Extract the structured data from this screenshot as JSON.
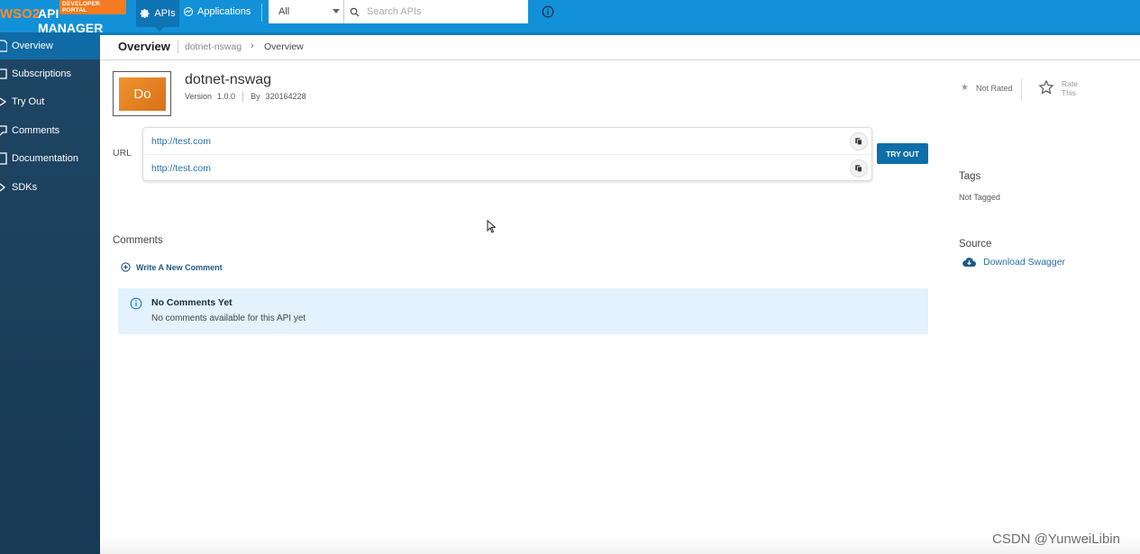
{
  "header": {
    "logo_wso2": "WSO2",
    "logo_title": "API MANAGER",
    "logo_badge": "DEVELOPER PORTAL",
    "nav_apis": "APIs",
    "nav_applications": "Applications",
    "search_filter": "All",
    "search_placeholder": "Search APIs"
  },
  "sidebar": {
    "items": [
      {
        "label": "Overview",
        "active": true
      },
      {
        "label": "Subscriptions"
      },
      {
        "label": "Try Out"
      },
      {
        "label": "Comments"
      },
      {
        "label": "Documentation"
      },
      {
        "label": "SDKs"
      }
    ]
  },
  "breadcrumb": {
    "title": "Overview",
    "api": "dotnet-nswag",
    "current": "Overview"
  },
  "api": {
    "thumb_text": "Do",
    "name": "dotnet-nswag",
    "version_label": "Version",
    "version": "1.0.0",
    "by_label": "By",
    "owner": "320164228",
    "rating_text": "Not Rated",
    "rate_this_line1": "Rate",
    "rate_this_line2": "This"
  },
  "urls": {
    "label": "URL",
    "items": [
      "http://test.com",
      "http://test.com"
    ],
    "try_out": "TRY OUT"
  },
  "tags": {
    "title": "Tags",
    "value": "Not Tagged"
  },
  "source": {
    "title": "Source",
    "download": "Download Swagger"
  },
  "comments": {
    "title": "Comments",
    "write": "Write A New Comment",
    "empty_title": "No Comments Yet",
    "empty_desc": "No comments available for this API yet"
  },
  "watermark": "CSDN @YunweiLibin",
  "colors": {
    "topbar": "#1391d8",
    "sidebar": "#1c3f5a",
    "accent": "#0d6ea8",
    "info_bg": "#e3f2fc"
  }
}
